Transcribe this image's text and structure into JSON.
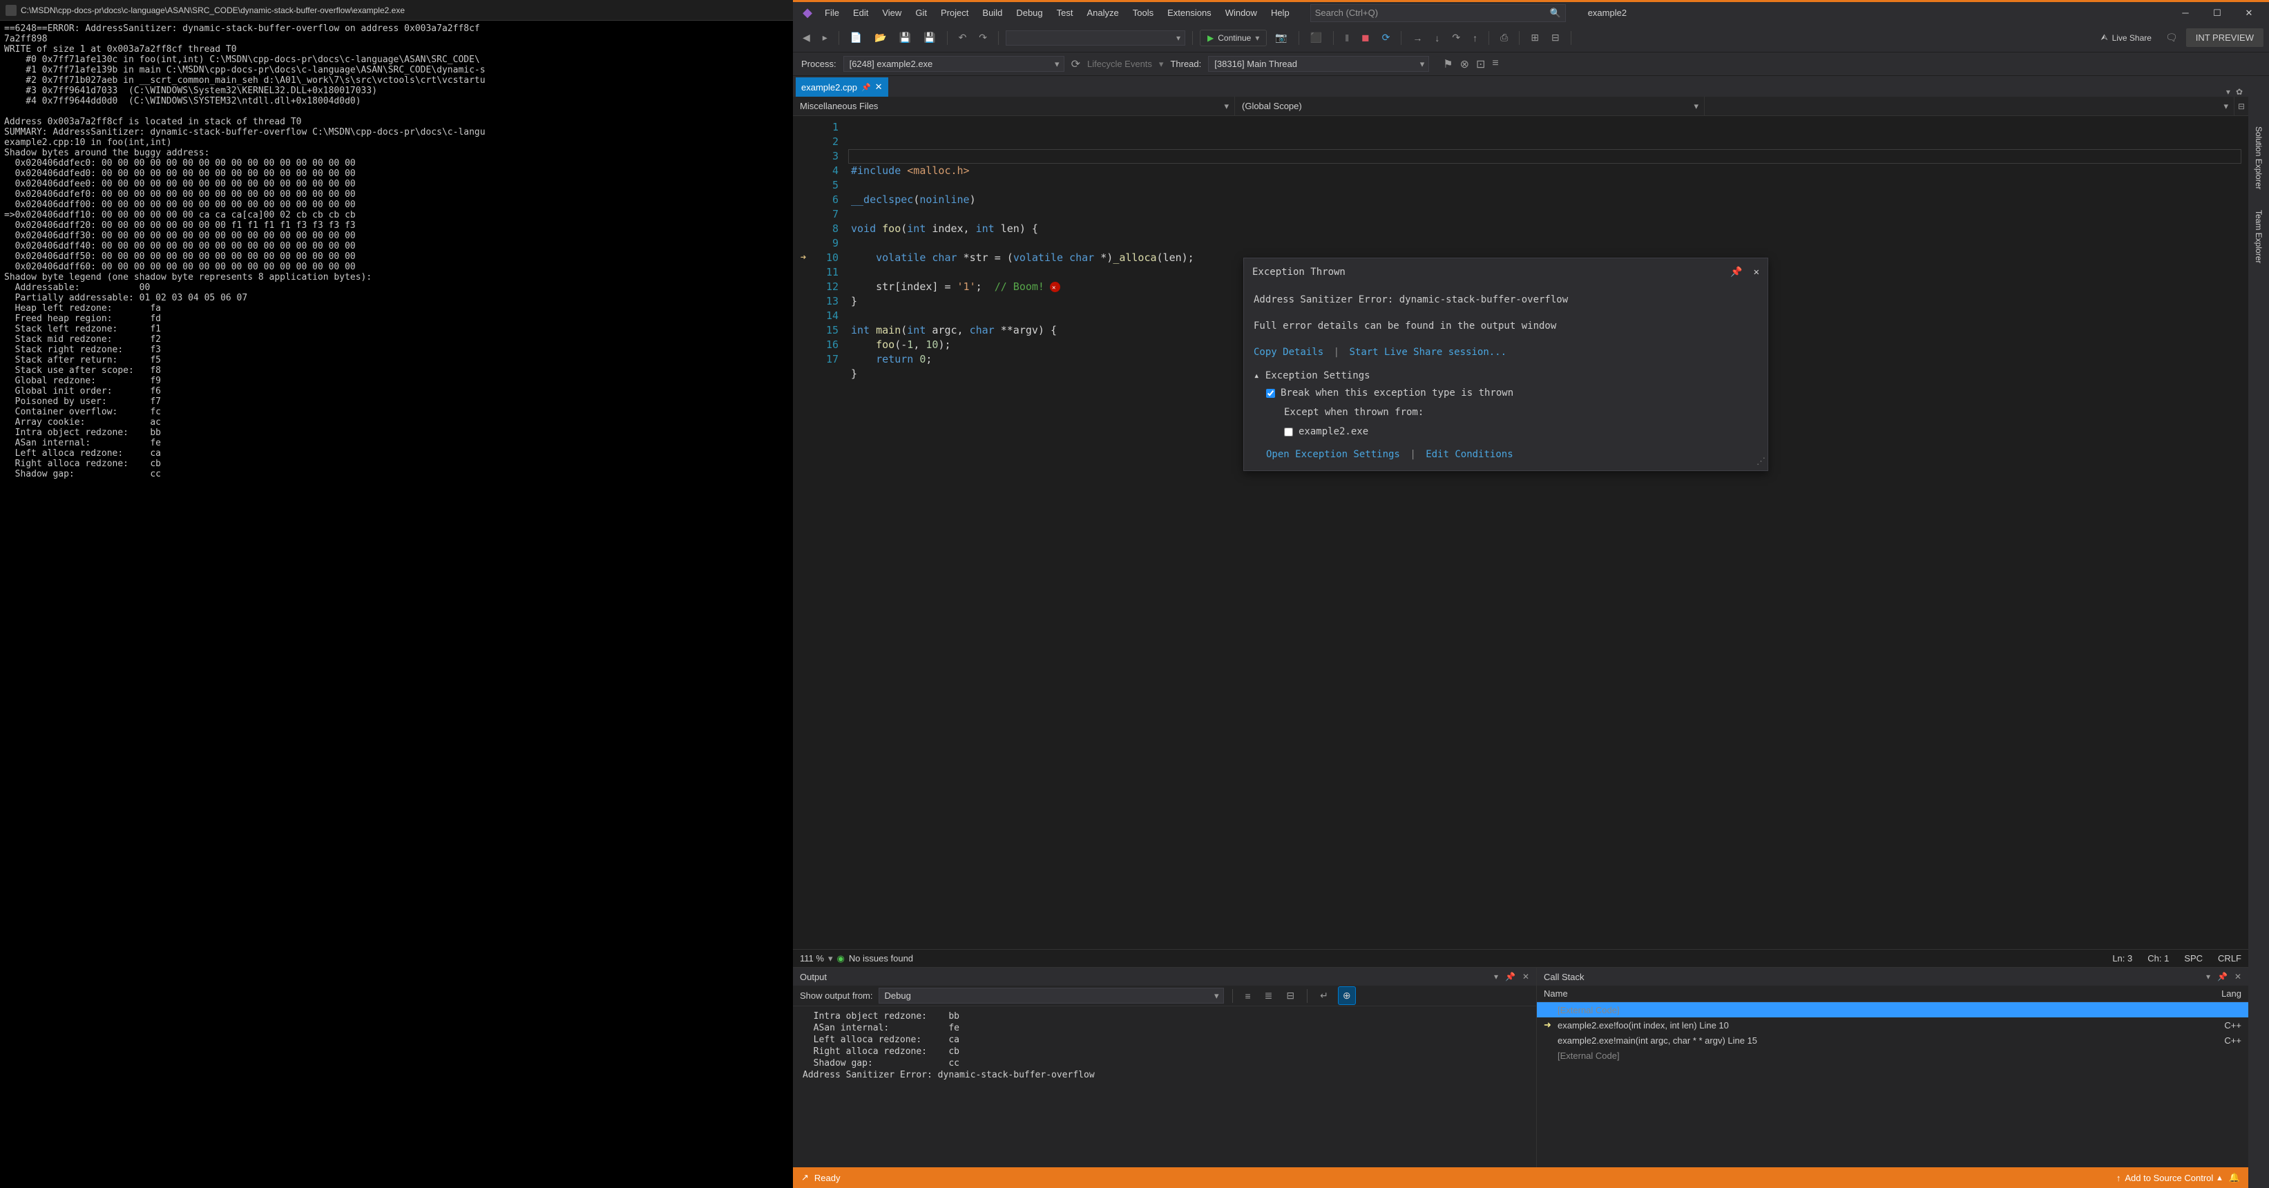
{
  "cmd": {
    "title": "C:\\MSDN\\cpp-docs-pr\\docs\\c-language\\ASAN\\SRC_CODE\\dynamic-stack-buffer-overflow\\example2.exe",
    "body": "==6248==ERROR: AddressSanitizer: dynamic-stack-buffer-overflow on address 0x003a7a2ff8cf\n7a2ff898\nWRITE of size 1 at 0x003a7a2ff8cf thread T0\n    #0 0x7ff71afe130c in foo(int,int) C:\\MSDN\\cpp-docs-pr\\docs\\c-language\\ASAN\\SRC_CODE\\\n    #1 0x7ff71afe139b in main C:\\MSDN\\cpp-docs-pr\\docs\\c-language\\ASAN\\SRC_CODE\\dynamic-s\n    #2 0x7ff71b027aeb in __scrt_common_main_seh d:\\A01\\_work\\7\\s\\src\\vctools\\crt\\vcstartu\n    #3 0x7ff9641d7033  (C:\\WINDOWS\\System32\\KERNEL32.DLL+0x180017033)\n    #4 0x7ff9644dd0d0  (C:\\WINDOWS\\SYSTEM32\\ntdll.dll+0x18004d0d0)\n\nAddress 0x003a7a2ff8cf is located in stack of thread T0\nSUMMARY: AddressSanitizer: dynamic-stack-buffer-overflow C:\\MSDN\\cpp-docs-pr\\docs\\c-langu\nexample2.cpp:10 in foo(int,int)\nShadow bytes around the buggy address:\n  0x020406ddfec0: 00 00 00 00 00 00 00 00 00 00 00 00 00 00 00 00\n  0x020406ddfed0: 00 00 00 00 00 00 00 00 00 00 00 00 00 00 00 00\n  0x020406ddfee0: 00 00 00 00 00 00 00 00 00 00 00 00 00 00 00 00\n  0x020406ddfef0: 00 00 00 00 00 00 00 00 00 00 00 00 00 00 00 00\n  0x020406ddff00: 00 00 00 00 00 00 00 00 00 00 00 00 00 00 00 00\n=>0x020406ddff10: 00 00 00 00 00 00 ca ca ca[ca]00 02 cb cb cb cb\n  0x020406ddff20: 00 00 00 00 00 00 00 00 f1 f1 f1 f1 f3 f3 f3 f3\n  0x020406ddff30: 00 00 00 00 00 00 00 00 00 00 00 00 00 00 00 00\n  0x020406ddff40: 00 00 00 00 00 00 00 00 00 00 00 00 00 00 00 00\n  0x020406ddff50: 00 00 00 00 00 00 00 00 00 00 00 00 00 00 00 00\n  0x020406ddff60: 00 00 00 00 00 00 00 00 00 00 00 00 00 00 00 00\nShadow byte legend (one shadow byte represents 8 application bytes):\n  Addressable:           00\n  Partially addressable: 01 02 03 04 05 06 07\n  Heap left redzone:       fa\n  Freed heap region:       fd\n  Stack left redzone:      f1\n  Stack mid redzone:       f2\n  Stack right redzone:     f3\n  Stack after return:      f5\n  Stack use after scope:   f8\n  Global redzone:          f9\n  Global init order:       f6\n  Poisoned by user:        f7\n  Container overflow:      fc\n  Array cookie:            ac\n  Intra object redzone:    bb\n  ASan internal:           fe\n  Left alloca redzone:     ca\n  Right alloca redzone:    cb\n  Shadow gap:              cc"
  },
  "menu": {
    "file": "File",
    "edit": "Edit",
    "view": "View",
    "git": "Git",
    "project": "Project",
    "build": "Build",
    "debug": "Debug",
    "test": "Test",
    "analyze": "Analyze",
    "tools": "Tools",
    "extensions": "Extensions",
    "window": "Window",
    "help": "Help"
  },
  "search_ph": "Search (Ctrl+Q)",
  "solution": "example2",
  "toolbar": {
    "continue": "Continue",
    "liveshare": "Live Share",
    "intprev": "INT PREVIEW"
  },
  "dbgbar": {
    "process_lbl": "Process:",
    "process_val": "[6248] example2.exe",
    "lifecycle": "Lifecycle Events",
    "thread_lbl": "Thread:",
    "thread_val": "[38316] Main Thread"
  },
  "tab": {
    "name": "example2.cpp"
  },
  "nav": {
    "left": "Miscellaneous Files",
    "mid": "(Global Scope)",
    "right": ""
  },
  "code": {
    "lines": [
      "",
      "#include <malloc.h>",
      "",
      "__declspec(noinline)",
      "",
      "void foo(int index, int len) {",
      "",
      "    volatile char *str = (volatile char *)_alloca(len);",
      "",
      "    str[index] = '1';  // Boom!",
      "}",
      "",
      "int main(int argc, char **argv) {",
      "    foo(-1, 10);",
      "    return 0;",
      "}",
      ""
    ]
  },
  "exc": {
    "title": "Exception Thrown",
    "err": "Address Sanitizer Error: dynamic-stack-buffer-overflow",
    "detail": "Full error details can be found in the output window",
    "copy": "Copy Details",
    "start": "Start Live Share session...",
    "settings": "Exception Settings",
    "break": "Break when this exception type is thrown",
    "except": "Except when thrown from:",
    "module": "example2.exe",
    "open": "Open Exception Settings",
    "edit": "Edit Conditions"
  },
  "rails": {
    "sln": "Solution Explorer",
    "team": "Team Explorer"
  },
  "statusline": {
    "zoom": "111 %",
    "issues": "No issues found",
    "ln": "Ln: 3",
    "ch": "Ch: 1",
    "spc": "SPC",
    "crlf": "CRLF"
  },
  "output": {
    "title": "Output",
    "from_lbl": "Show output from:",
    "from_val": "Debug",
    "body": "  Intra object redzone:    bb\n  ASan internal:           fe\n  Left alloca redzone:     ca\n  Right alloca redzone:    cb\n  Shadow gap:              cc\nAddress Sanitizer Error: dynamic-stack-buffer-overflow"
  },
  "callstack": {
    "title": "Call Stack",
    "col_name": "Name",
    "col_lang": "Lang",
    "rows": [
      {
        "name": "[External Code]",
        "lang": "",
        "dim": true,
        "sel": true
      },
      {
        "name": "example2.exe!foo(int index, int len) Line 10",
        "lang": "C++",
        "arrow": true
      },
      {
        "name": "example2.exe!main(int argc, char * * argv) Line 15",
        "lang": "C++"
      },
      {
        "name": "[External Code]",
        "lang": "",
        "dim": true
      }
    ]
  },
  "statusbar": {
    "ready": "Ready",
    "src": "Add to Source Control"
  }
}
